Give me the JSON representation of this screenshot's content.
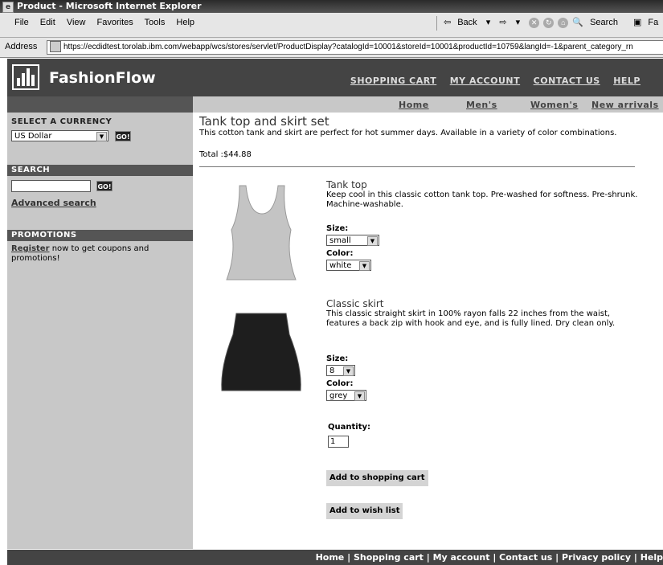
{
  "window": {
    "title": "Product - Microsoft Internet Explorer"
  },
  "menu": [
    "File",
    "Edit",
    "View",
    "Favorites",
    "Tools",
    "Help"
  ],
  "toolbar": {
    "back": "Back",
    "search": "Search",
    "favorites": "Fa"
  },
  "address": {
    "label": "Address",
    "url": "https://ecdidtest.torolab.ibm.com/webapp/wcs/stores/servlet/ProductDisplay?catalogId=10001&storeId=10001&productId=10759&langId=-1&parent_category_rn"
  },
  "site": {
    "brand": "FashionFlow",
    "topnav": [
      "SHOPPING CART",
      "MY ACCOUNT",
      "CONTACT US",
      "HELP"
    ],
    "subnav": [
      "Home",
      "Men's",
      "Women's",
      "New arrivals"
    ]
  },
  "left": {
    "currency_heading": "SELECT A CURRENCY",
    "currency_value": "US Dollar",
    "go": "GO!",
    "search_heading": "SEARCH",
    "search_value": "",
    "advanced": "Advanced search",
    "promo_heading": "PROMOTIONS",
    "promo_link": "Register",
    "promo_text": " now to get coupons and promotions!"
  },
  "product": {
    "title": "Tank top and skirt set",
    "description": "This cotton tank and skirt are perfect for hot summer days. Available in a variety of color combinations.",
    "total": "Total :$44.88",
    "items": [
      {
        "name": "Tank top",
        "description": "Keep cool in this classic cotton tank top. Pre-washed for softness. Pre-shrunk. Machine-washable.",
        "size_label": "Size:",
        "size": "small",
        "color_label": "Color:",
        "color": "white"
      },
      {
        "name": "Classic skirt",
        "description": "This classic straight skirt in 100% rayon falls 22 inches from the waist, features a back zip with hook and eye, and is fully lined. Dry clean only.",
        "size_label": "Size:",
        "size": "8",
        "color_label": "Color:",
        "color": "grey"
      }
    ],
    "quantity_label": "Quantity:",
    "quantity": "1",
    "add_cart": "Add to shopping cart",
    "add_wish": "Add to wish list"
  },
  "footer": "Home | Shopping cart | My account | Contact us | Privacy policy | Help"
}
